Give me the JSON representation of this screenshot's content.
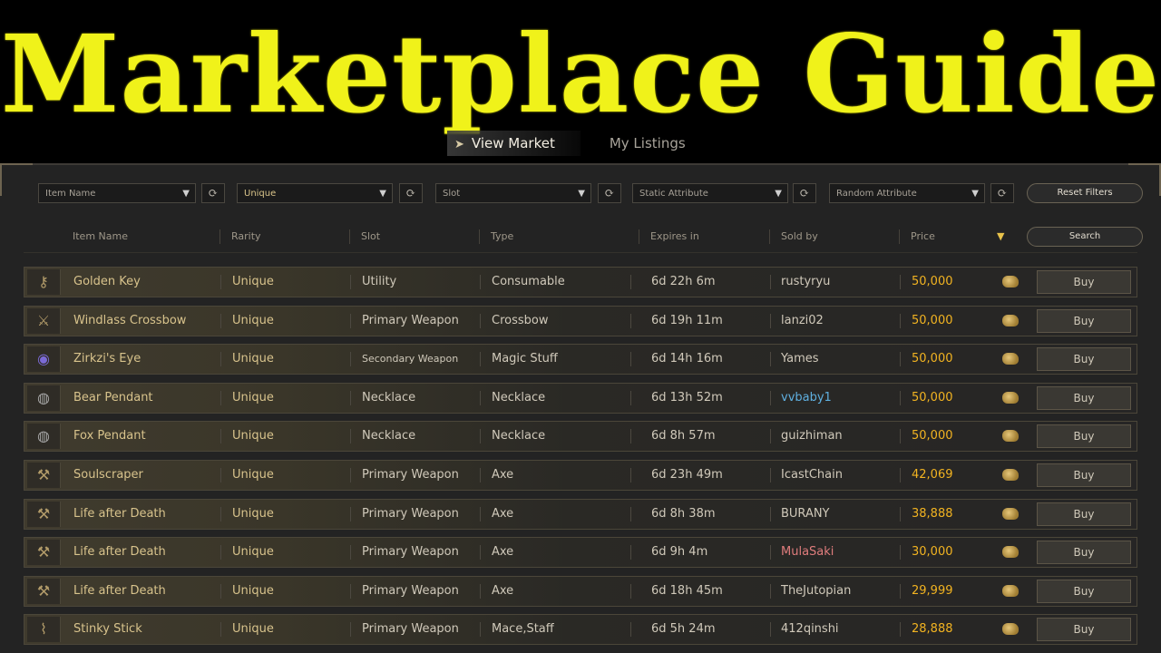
{
  "banner": {
    "title": "Marketplace Guide"
  },
  "tabs": {
    "view_market": "View Market",
    "my_listings": "My Listings"
  },
  "filters": {
    "item_name": "Item Name",
    "rarity": "Unique",
    "slot": "Slot",
    "static_attribute": "Static Attribute",
    "random_attribute": "Random Attribute",
    "reset_label": "Reset Filters",
    "search_label": "Search"
  },
  "columns": {
    "item_name": "Item Name",
    "rarity": "Rarity",
    "slot": "Slot",
    "type": "Type",
    "expires": "Expires in",
    "sold_by": "Sold by",
    "price": "Price"
  },
  "rows": [
    {
      "name": "Golden Key",
      "rarity": "Unique",
      "slot": "Utility",
      "type": "Consumable",
      "expires": "6d 22h 6m",
      "seller": "rustyryu",
      "price": "50,000",
      "buy": "Buy",
      "icon": "key-icon"
    },
    {
      "name": "Windlass Crossbow",
      "rarity": "Unique",
      "slot": "Primary Weapon",
      "type": "Crossbow",
      "expires": "6d 19h 11m",
      "seller": "lanzi02",
      "price": "50,000",
      "buy": "Buy",
      "icon": "crossbow-icon"
    },
    {
      "name": "Zirkzi's Eye",
      "rarity": "Unique",
      "slot": "Secondary Weapon",
      "type": "Magic Stuff",
      "expires": "6d 14h 16m",
      "seller": "Yames",
      "price": "50,000",
      "buy": "Buy",
      "icon": "eye-icon"
    },
    {
      "name": "Bear Pendant",
      "rarity": "Unique",
      "slot": "Necklace",
      "type": "Necklace",
      "expires": "6d 13h 52m",
      "seller": "vvbaby1",
      "price": "50,000",
      "buy": "Buy",
      "icon": "pendant-icon"
    },
    {
      "name": "Fox Pendant",
      "rarity": "Unique",
      "slot": "Necklace",
      "type": "Necklace",
      "expires": "6d 8h 57m",
      "seller": "guizhiman",
      "price": "50,000",
      "buy": "Buy",
      "icon": "pendant-icon"
    },
    {
      "name": "Soulscraper",
      "rarity": "Unique",
      "slot": "Primary Weapon",
      "type": "Axe",
      "expires": "6d 23h 49m",
      "seller": "IcastChain",
      "price": "42,069",
      "buy": "Buy",
      "icon": "axe-icon"
    },
    {
      "name": "Life after Death",
      "rarity": "Unique",
      "slot": "Primary Weapon",
      "type": "Axe",
      "expires": "6d 8h 38m",
      "seller": "BURANY",
      "price": "38,888",
      "buy": "Buy",
      "icon": "axe-icon"
    },
    {
      "name": "Life after Death",
      "rarity": "Unique",
      "slot": "Primary Weapon",
      "type": "Axe",
      "expires": "6d 9h 4m",
      "seller": "MulaSaki",
      "price": "30,000",
      "buy": "Buy",
      "icon": "axe-icon"
    },
    {
      "name": "Life after Death",
      "rarity": "Unique",
      "slot": "Primary Weapon",
      "type": "Axe",
      "expires": "6d 18h 45m",
      "seller": "TheJutopian",
      "price": "29,999",
      "buy": "Buy",
      "icon": "axe-icon"
    },
    {
      "name": "Stinky Stick",
      "rarity": "Unique",
      "slot": "Primary Weapon",
      "type": "Mace,Staff",
      "expires": "6d 5h 24m",
      "seller": "412qinshi",
      "price": "28,888",
      "buy": "Buy",
      "icon": "staff-icon"
    }
  ],
  "colors": {
    "banner": "#f0f21a",
    "price": "#f2b321",
    "seller_blue": "#5fb0e0",
    "seller_red": "#e07d7d"
  }
}
